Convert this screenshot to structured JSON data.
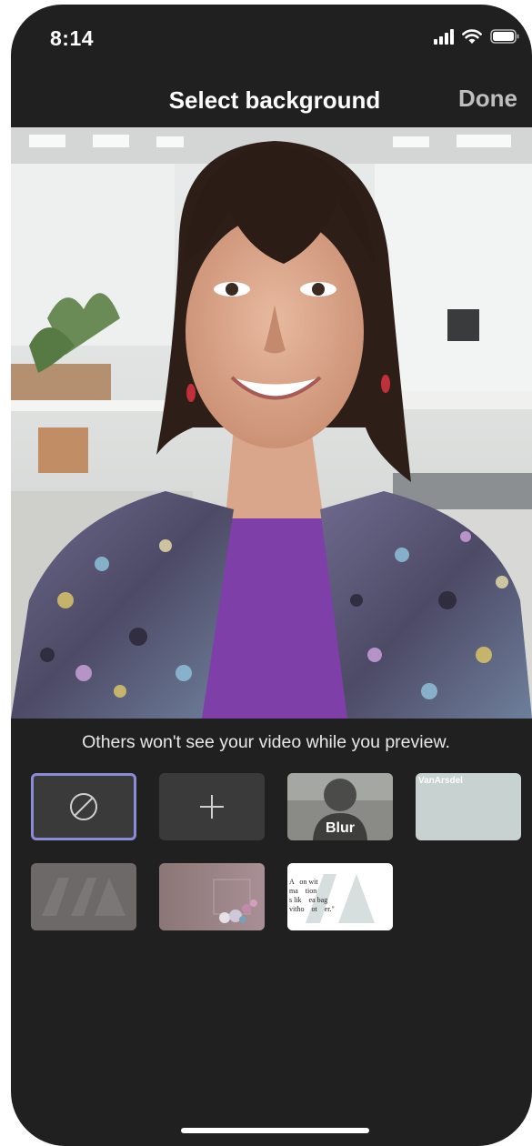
{
  "status_bar": {
    "time": "8:14",
    "icons": [
      "signal-icon",
      "wifi-icon",
      "battery-icon"
    ]
  },
  "header": {
    "title": "Select background",
    "done_label": "Done"
  },
  "preview": {
    "hint": "Others won't see your video while you preview."
  },
  "backgrounds": [
    {
      "id": "none",
      "icon": "no-background-icon",
      "selected": true
    },
    {
      "id": "add",
      "icon": "plus-icon"
    },
    {
      "id": "blur",
      "label": "Blur"
    },
    {
      "id": "vanarsdel-plain",
      "brand": "VanArsdel"
    },
    {
      "id": "va-logo-dark"
    },
    {
      "id": "pink-room"
    },
    {
      "id": "quote-card",
      "text": "A   on wit\nma    tion\ns lik    ea bag\nvitho    ot    er.\""
    }
  ],
  "colors": {
    "selection": "#8b8bd6",
    "background": "#202020",
    "done": "#bfbfbf"
  }
}
